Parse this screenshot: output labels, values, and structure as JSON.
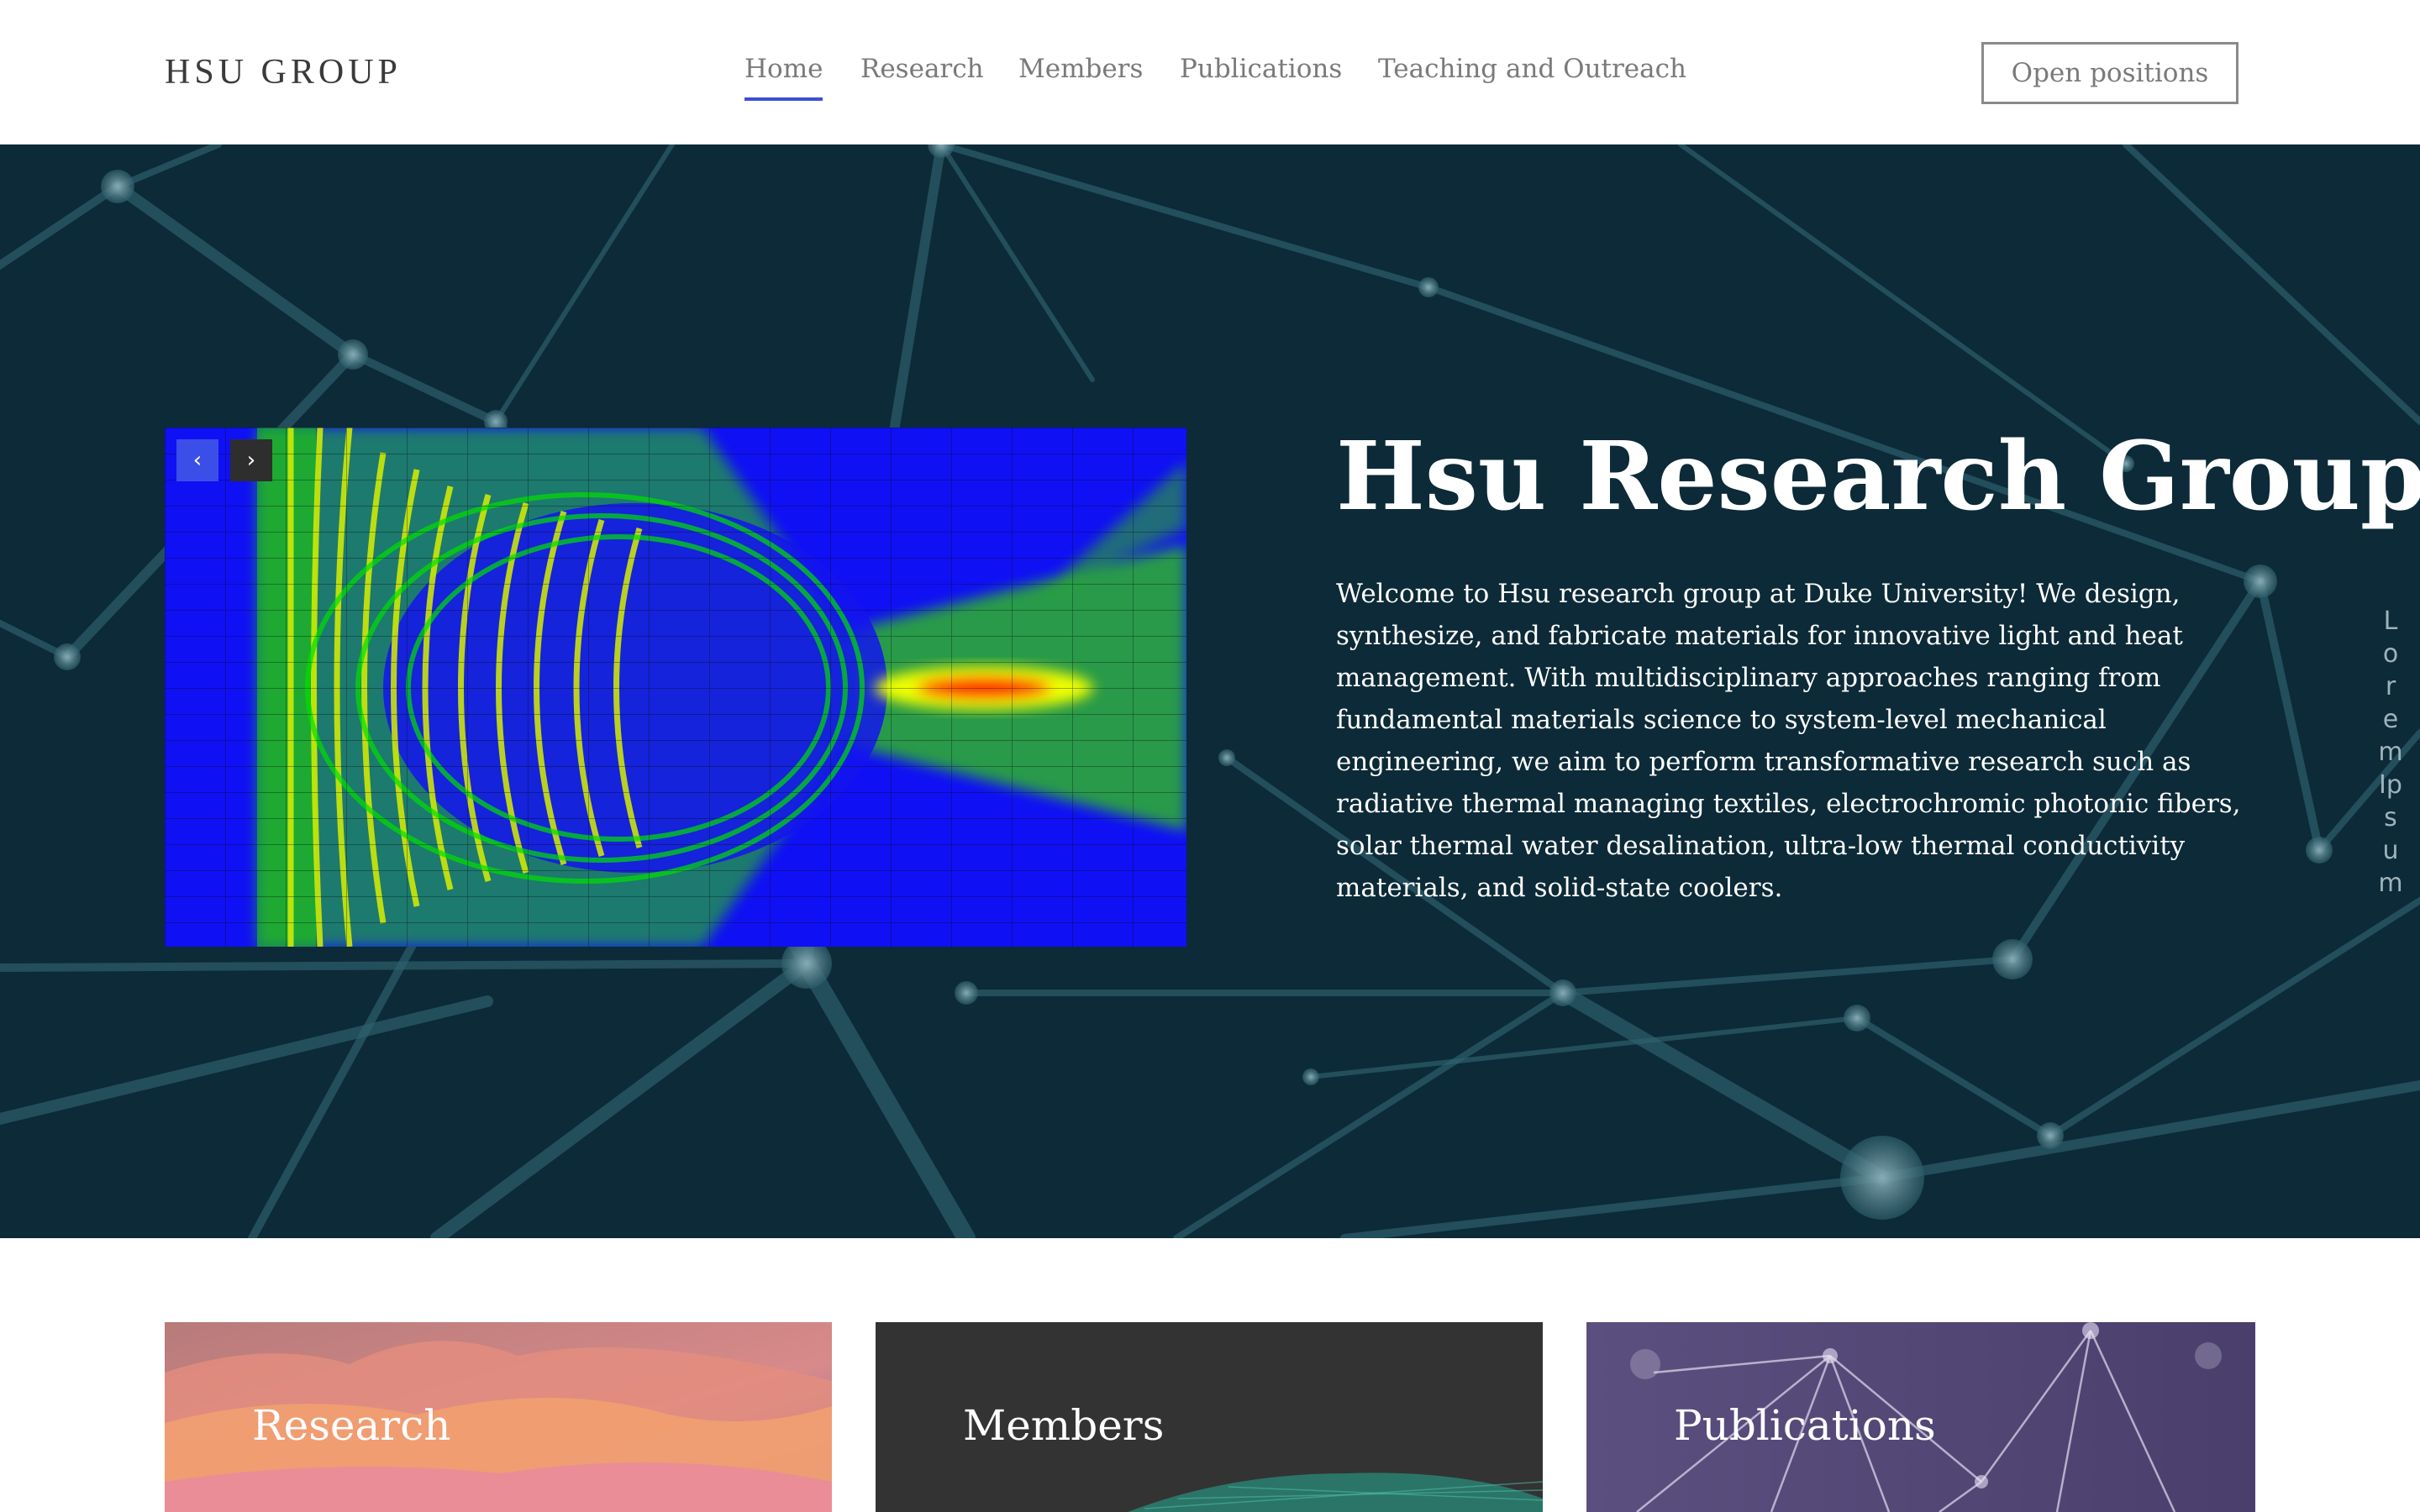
{
  "header": {
    "logo": "HSU GROUP",
    "nav": [
      {
        "label": "Home",
        "active": true
      },
      {
        "label": "Research",
        "active": false
      },
      {
        "label": "Members",
        "active": false
      },
      {
        "label": "Publications",
        "active": false
      },
      {
        "label": "Teaching and Outreach",
        "active": false
      }
    ],
    "cta_label": "Open positions",
    "accent_color": "#3b4fd3"
  },
  "hero": {
    "title": "Hsu Research Group",
    "description": "Welcome to Hsu research group at Duke University! We design, synthesize, and fabricate materials for innovative light and heat management. With multidisciplinary approaches ranging from fundamental materials science to system-level mechanical engineering, we aim to perform transformative research such as radiative thermal managing textiles, electrochromic photonic fibers, solar thermal water desalination, ultra-low thermal conductivity materials, and solid-state coolers.",
    "side_text": "Lorem Ipsum",
    "background_color": "#0c2a37",
    "slider": {
      "prev_icon": "chevron-left-icon",
      "next_icon": "chevron-right-icon"
    }
  },
  "cards": [
    {
      "title": "Research"
    },
    {
      "title": "Members"
    },
    {
      "title": "Publications"
    }
  ]
}
